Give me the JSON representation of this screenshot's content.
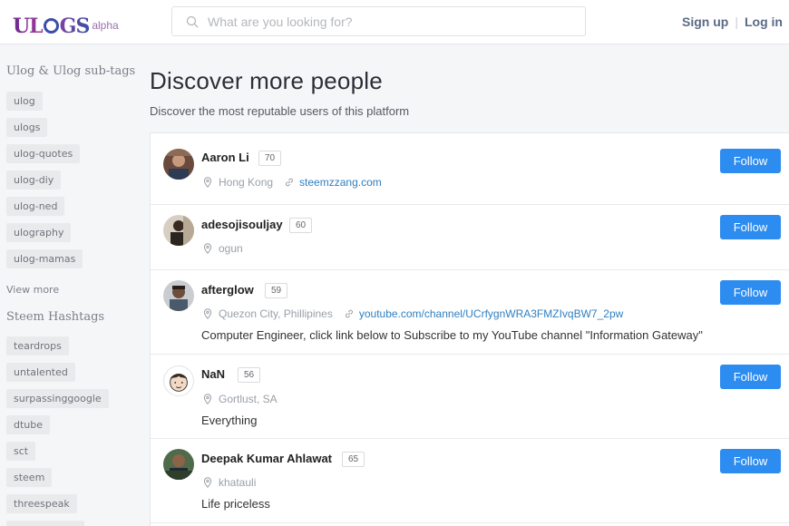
{
  "header": {
    "logo_text": "ULOGS",
    "logo_badge": "alpha",
    "search_placeholder": "What are you looking for?",
    "signup_label": "Sign up",
    "separator": "|",
    "login_label": "Log in"
  },
  "sidebar": {
    "section1_title": "Ulog & Ulog sub-tags",
    "tags1": [
      "ulog",
      "ulogs",
      "ulog-quotes",
      "ulog-diy",
      "ulog-ned",
      "ulography",
      "ulog-mamas"
    ],
    "view_more": "View more",
    "section2_title": "Steem Hashtags",
    "tags2": [
      "teardrops",
      "untalented",
      "surpassinggoogle",
      "dtube",
      "sct",
      "steem",
      "threespeak",
      "photography"
    ]
  },
  "main": {
    "title": "Discover more people",
    "subtitle": "Discover the most reputable users of this platform",
    "follow_label": "Follow",
    "users": [
      {
        "name": "Aaron Li",
        "rep": "70",
        "location": "Hong Kong",
        "website": "steemzzang.com",
        "bio": ""
      },
      {
        "name": "adesojisouljay",
        "rep": "60",
        "location": "ogun",
        "website": "",
        "bio": ""
      },
      {
        "name": "afterglow",
        "rep": "59",
        "location": "Quezon City, Phillipines",
        "website": "youtube.com/channel/UCrfygnWRA3FMZIvqBW7_2pw",
        "bio": "Computer Engineer, click link below to Subscribe to my YouTube channel \"Information Gateway\""
      },
      {
        "name": "NaN",
        "rep": "56",
        "location": "Gortlust, SA",
        "website": "",
        "bio": "Everything"
      },
      {
        "name": "Deepak Kumar Ahlawat",
        "rep": "65",
        "location": "khatauli",
        "website": "",
        "bio": "Life priceless"
      }
    ]
  },
  "colors": {
    "accent": "#2d8cf0",
    "link": "#2f7fc1"
  }
}
